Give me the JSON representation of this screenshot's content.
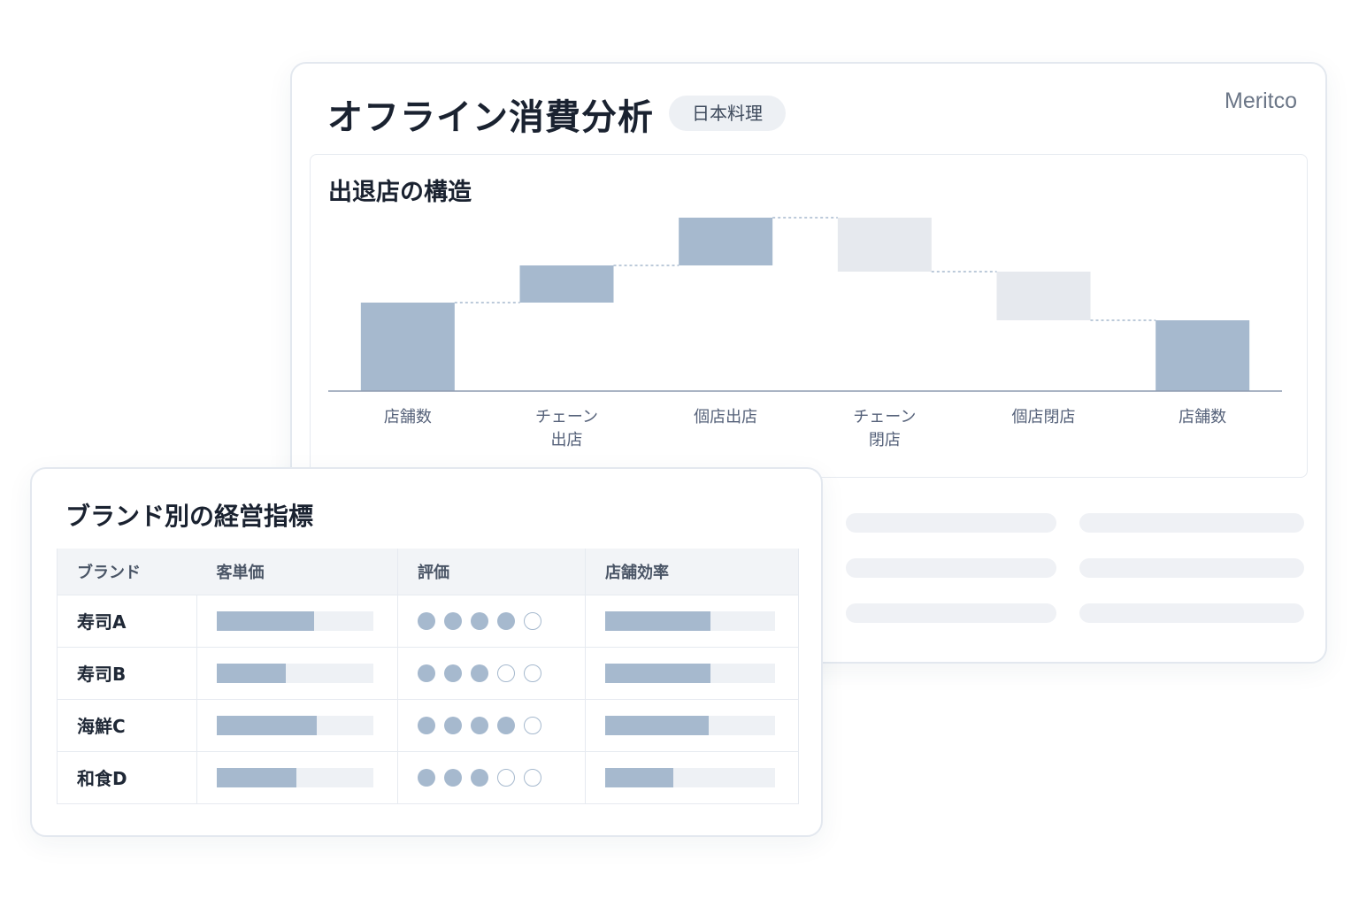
{
  "header": {
    "title": "オフライン消費分析",
    "tag": "日本料理",
    "brand": "Meritco"
  },
  "chart_data": {
    "type": "waterfall",
    "title": "出退店の構造",
    "steps": [
      {
        "label": "店舗数",
        "kind": "total",
        "value": 100
      },
      {
        "label": "チェーン\n出店",
        "kind": "increase",
        "value": 42
      },
      {
        "label": "個店出店",
        "kind": "increase",
        "value": 54
      },
      {
        "label": "チェーン\n閉店",
        "kind": "decrease",
        "value": -61
      },
      {
        "label": "個店閉店",
        "kind": "decrease",
        "value": -55
      },
      {
        "label": "店舗数",
        "kind": "total",
        "value": 80
      }
    ],
    "colors": {
      "total": "#a6b9ce",
      "increase": "#a6b9ce",
      "decrease": "#e6e9ee",
      "connector": "#a6b9ce",
      "axis": "#8e9cb0"
    },
    "ylim": [
      0,
      200
    ],
    "grid": false
  },
  "table": {
    "title": "ブランド別の経営指標",
    "columns": [
      "ブランド",
      "客単価",
      "評価",
      "店舗効率"
    ],
    "rows": [
      {
        "brand": "寿司A",
        "price": 0.62,
        "rating": 4,
        "efficiency": 0.62
      },
      {
        "brand": "寿司B",
        "price": 0.44,
        "rating": 3,
        "efficiency": 0.62
      },
      {
        "brand": "海鮮C",
        "price": 0.64,
        "rating": 4,
        "efficiency": 0.61
      },
      {
        "brand": "和食D",
        "price": 0.51,
        "rating": 3,
        "efficiency": 0.4
      }
    ],
    "rating_max": 5
  }
}
